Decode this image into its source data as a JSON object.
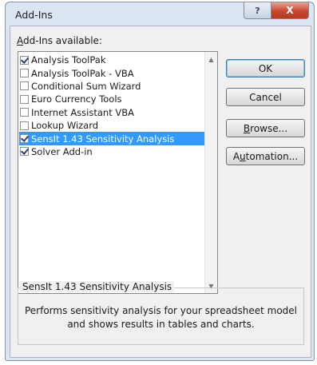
{
  "window": {
    "title": "Add-Ins",
    "help_glyph": "?",
    "close_glyph": "X"
  },
  "list": {
    "label_mnemonic": "A",
    "label_rest": "dd-Ins available:",
    "items": [
      {
        "label": "Analysis ToolPak",
        "checked": true,
        "selected": false
      },
      {
        "label": "Analysis ToolPak - VBA",
        "checked": false,
        "selected": false
      },
      {
        "label": "Conditional Sum Wizard",
        "checked": false,
        "selected": false
      },
      {
        "label": "Euro Currency Tools",
        "checked": false,
        "selected": false
      },
      {
        "label": "Internet Assistant VBA",
        "checked": false,
        "selected": false
      },
      {
        "label": "Lookup Wizard",
        "checked": false,
        "selected": false
      },
      {
        "label": "SensIt 1.43 Sensitivity Analysis",
        "checked": true,
        "selected": true
      },
      {
        "label": "Solver Add-in",
        "checked": true,
        "selected": false
      }
    ],
    "scroll_up_glyph": "▲",
    "scroll_down_glyph": "▼"
  },
  "buttons": {
    "ok": "OK",
    "cancel": "Cancel",
    "browse_mnemonic": "B",
    "browse_rest": "rowse...",
    "automation_pre": "A",
    "automation_mnemonic": "u",
    "automation_rest": "tomation..."
  },
  "description": {
    "title": "SensIt 1.43 Sensitivity Analysis",
    "text": "Performs sensitivity analysis for your spreadsheet model and shows results in tables and charts."
  }
}
